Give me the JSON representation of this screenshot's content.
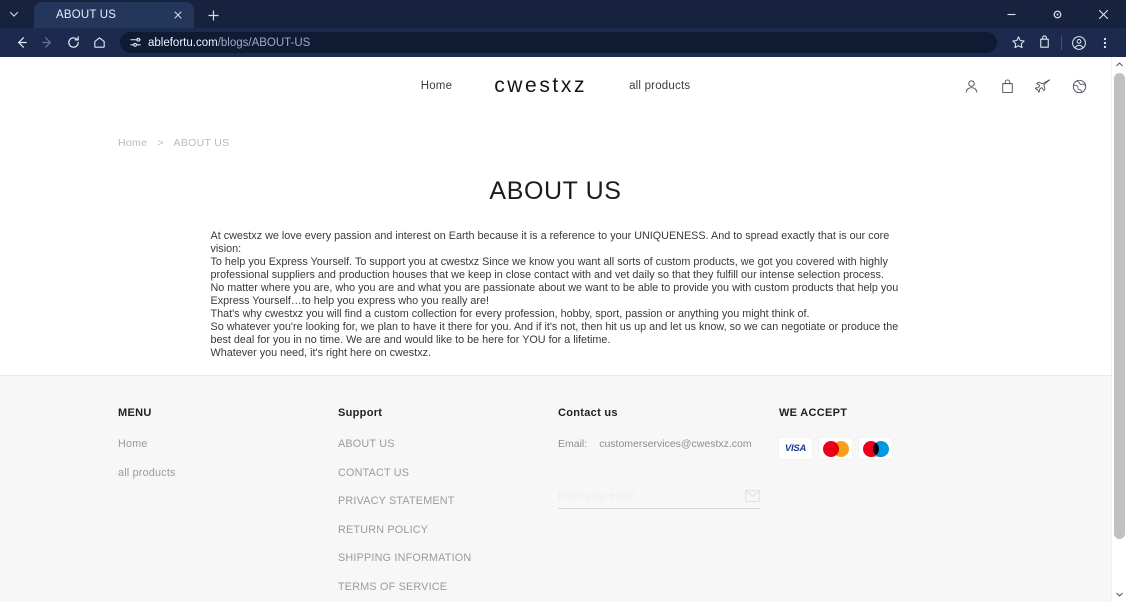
{
  "browser": {
    "tab": {
      "title": "ABOUT US",
      "close_icon": "close-icon"
    },
    "new_tab_label": "+",
    "tab_list_icon": "chevron-down-icon",
    "nav": {
      "back_icon": "arrow-back-icon",
      "forward_icon": "arrow-forward-icon",
      "reload_icon": "reload-icon",
      "home_icon": "home-icon"
    },
    "omnibox": {
      "site_settings_icon": "tune-icon",
      "url_domain": "ablefortu.com",
      "url_path": "/blogs/ABOUT-US",
      "bookmark_icon": "star-icon"
    },
    "toolbar_right": {
      "extensions_icon": "extensions-icon",
      "profile_icon": "profile-icon",
      "menu_icon": "kebab-menu-icon"
    },
    "window": {
      "minimize_icon": "minimize-icon",
      "maximize_icon": "maximize-icon",
      "close_icon": "window-close-icon"
    }
  },
  "site": {
    "brand": "cwestxz",
    "nav": [
      {
        "label": "Home",
        "name": "nav-home"
      },
      {
        "label": "all products",
        "name": "nav-all-products"
      }
    ],
    "header_icons": [
      {
        "name": "account-icon"
      },
      {
        "name": "shopping-bag-icon"
      },
      {
        "name": "airplane-icon"
      },
      {
        "name": "globe-icon"
      }
    ],
    "breadcrumb": {
      "home": "Home",
      "separator": ">",
      "current": "ABOUT US"
    },
    "title": "ABOUT US",
    "paragraphs": [
      "At cwestxz we love every passion and interest on Earth because it is a reference to your UNIQUENESS. And to spread exactly that is our core vision:",
      "To help you Express Yourself. To support you at cwestxz Since we know you want all sorts of custom products, we got you covered with highly professional suppliers and production houses that we keep in close contact with and vet daily so that they fulfill our intense selection process.",
      "No matter where you are, who you are and what you are passionate about we want to be able to provide you with custom products that help you Express Yourself…to help you express who you really are!",
      "That's why cwestxz you will find a custom collection for every profession, hobby, sport, passion or anything you might think of.",
      "So whatever you're looking for, we plan to have it there for you. And if it's not, then hit us up and let us know, so we can negotiate or produce the best deal for you in no time. We are and would like to be here for YOU for a lifetime.",
      "Whatever you need, it's right here on cwestxz."
    ]
  },
  "footer": {
    "menu": {
      "heading": "MENU",
      "links": [
        "Home",
        "all products"
      ]
    },
    "support": {
      "heading": "Support",
      "links": [
        "ABOUT US",
        "CONTACT US",
        "PRIVACY STATEMENT",
        "RETURN POLICY",
        "SHIPPING INFORMATION",
        "TERMS OF SERVICE"
      ]
    },
    "contact": {
      "heading": "Contact us",
      "email_label": "Email:",
      "email_value": "customerservices@cwestxz.com",
      "subscribe_placeholder": "Enter your email",
      "subscribe_value": "",
      "subscribe_icon": "envelope-icon"
    },
    "accept": {
      "heading": "WE ACCEPT",
      "cards": [
        {
          "name": "visa-card-icon",
          "label": "VISA"
        },
        {
          "name": "mastercard-card-icon",
          "label": ""
        },
        {
          "name": "maestro-card-icon",
          "label": "maestro"
        }
      ]
    }
  },
  "colors": {
    "chrome_tabstrip": "#17233e",
    "chrome_toolbar": "#1b2a4d",
    "omnibox": "#0f1a33",
    "footer_bg": "#f7f7f7",
    "text": "#3a3a3a",
    "muted": "#9b9b9b",
    "visa_blue": "#1a3d93",
    "mc_red": "#eb001b",
    "mc_orange": "#f79e1b",
    "maestro_blue": "#0099df"
  }
}
